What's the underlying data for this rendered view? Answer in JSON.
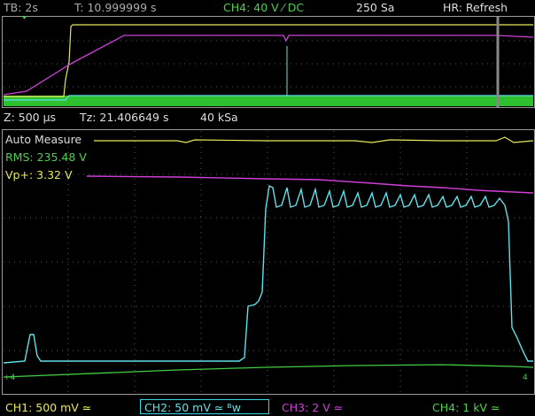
{
  "top_bar": {
    "timebase": "TB: 2s",
    "trigger_time": "T: 10.999999 s",
    "channel_setting": "CH4: 40 V ⁄ DC",
    "sample_count": "250 Sa",
    "mode": "HR: Refresh"
  },
  "zoom_bar": {
    "zoom_timebase": "Z: 500 µs",
    "zoom_time": "Tz: 21.406649 s",
    "zoom_samples": "40 kSa"
  },
  "measurements": {
    "title": "Auto Measure",
    "rms": "RMS: 235.48 V",
    "vp": "Vp+: 3.32 V"
  },
  "bottom_bar": {
    "ch1": "CH1: 500 mV ≃",
    "ch2": "CH2: 50 mV ≃ ᴮw",
    "ch3": "CH3: 2 V ≃",
    "ch4": "CH4: 1 kV ≃"
  },
  "colors": {
    "ch1": "#e8e85a",
    "ch2": "#5fe0ea",
    "ch3": "#d040d8",
    "ch4": "#44cc44",
    "text": "#dddddd",
    "grid": "#6a6a6a"
  }
}
